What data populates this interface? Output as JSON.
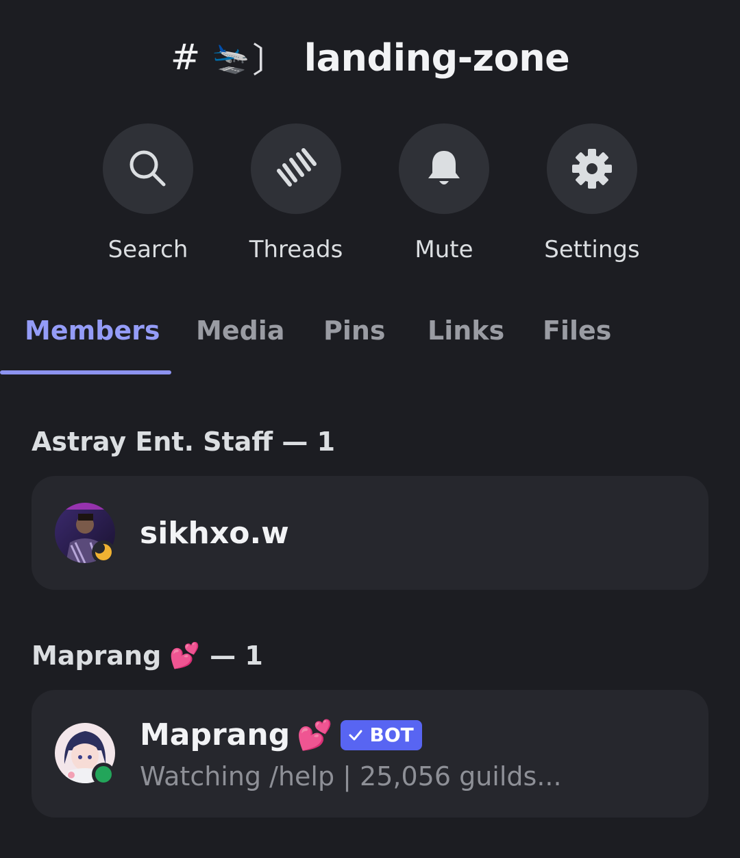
{
  "channel": {
    "hash": "#",
    "emoji": "🛬",
    "bracket": "〕",
    "name": "landing-zone"
  },
  "actions": [
    {
      "label": "Search",
      "icon": "search-icon"
    },
    {
      "label": "Threads",
      "icon": "threads-icon"
    },
    {
      "label": "Mute",
      "icon": "bell-icon"
    },
    {
      "label": "Settings",
      "icon": "gear-icon"
    }
  ],
  "tabs": [
    {
      "label": "Members",
      "active": true
    },
    {
      "label": "Media",
      "active": false
    },
    {
      "label": "Pins",
      "active": false
    },
    {
      "label": "Links",
      "active": false
    },
    {
      "label": "Files",
      "active": false
    }
  ],
  "sections": [
    {
      "header": "Astray Ent. Staff — 1",
      "members": [
        {
          "name": "sikhxo.w",
          "status": "idle",
          "avatar": "avatar-photo"
        }
      ]
    },
    {
      "header_text": "Maprang",
      "header_emoji": "💕",
      "header_count": "— 1",
      "members": [
        {
          "name": "Maprang",
          "name_emoji": "💕",
          "badge": "BOT",
          "activity": "Watching /help | 25,056 guilds...",
          "status": "online",
          "avatar": "avatar-anime"
        }
      ]
    }
  ],
  "colors": {
    "background": "#1c1d22",
    "card": "#26272d",
    "accent": "#949cf7",
    "bot_badge": "#5865f2",
    "idle": "#f0b232",
    "online": "#23a55a"
  }
}
